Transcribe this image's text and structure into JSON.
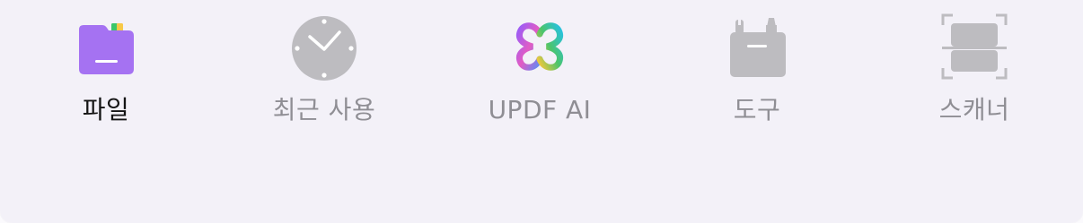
{
  "tabbar": {
    "items": [
      {
        "label": "파일",
        "icon": "folder-icon",
        "active": true
      },
      {
        "label": "최근 사용",
        "icon": "clock-icon",
        "active": false
      },
      {
        "label": "UPDF AI",
        "icon": "updf-ai-logo-icon",
        "active": false
      },
      {
        "label": "도구",
        "icon": "toolbox-icon",
        "active": false
      },
      {
        "label": "스캐너",
        "icon": "scanner-icon",
        "active": false
      }
    ]
  },
  "colors": {
    "background": "#f3f1f8",
    "active_label": "#141414",
    "inactive": "#8f8e94",
    "folder_purple": "#a572f2",
    "icon_gray": "#bdbcc0"
  }
}
